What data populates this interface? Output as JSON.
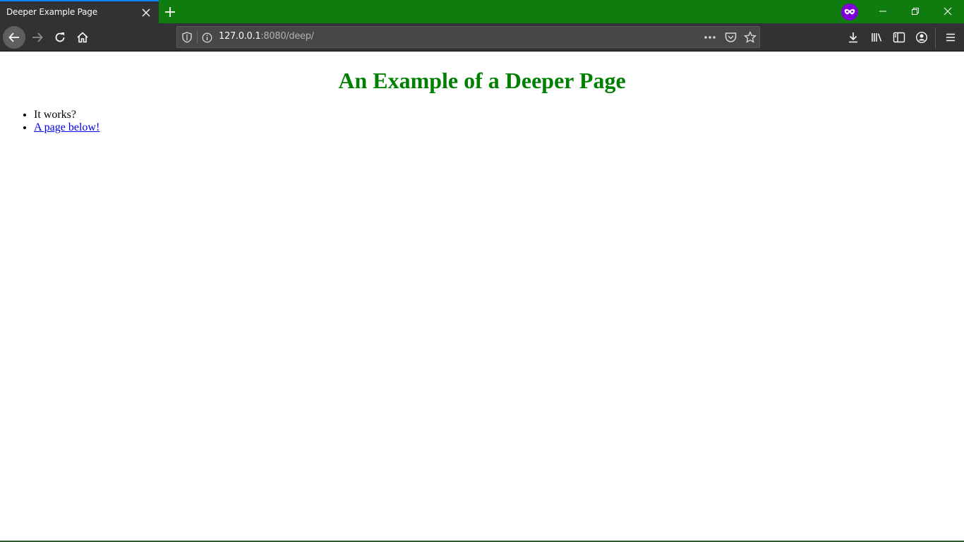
{
  "tab": {
    "title": "Deeper Example Page"
  },
  "toolbar": {
    "url_host": "127.0.0.1",
    "url_rest": ":8080/deep/"
  },
  "page": {
    "heading": "An Example of a Deeper Page",
    "list": [
      {
        "text": "It works?"
      },
      {
        "text": "A page below!"
      }
    ]
  },
  "colors": {
    "tab_strip": "#107c10",
    "toolbar": "#323234",
    "active_tab_accent": "#0a84ff",
    "heading": "#008000",
    "link": "#0000ee",
    "private_badge": "#8000d7"
  }
}
